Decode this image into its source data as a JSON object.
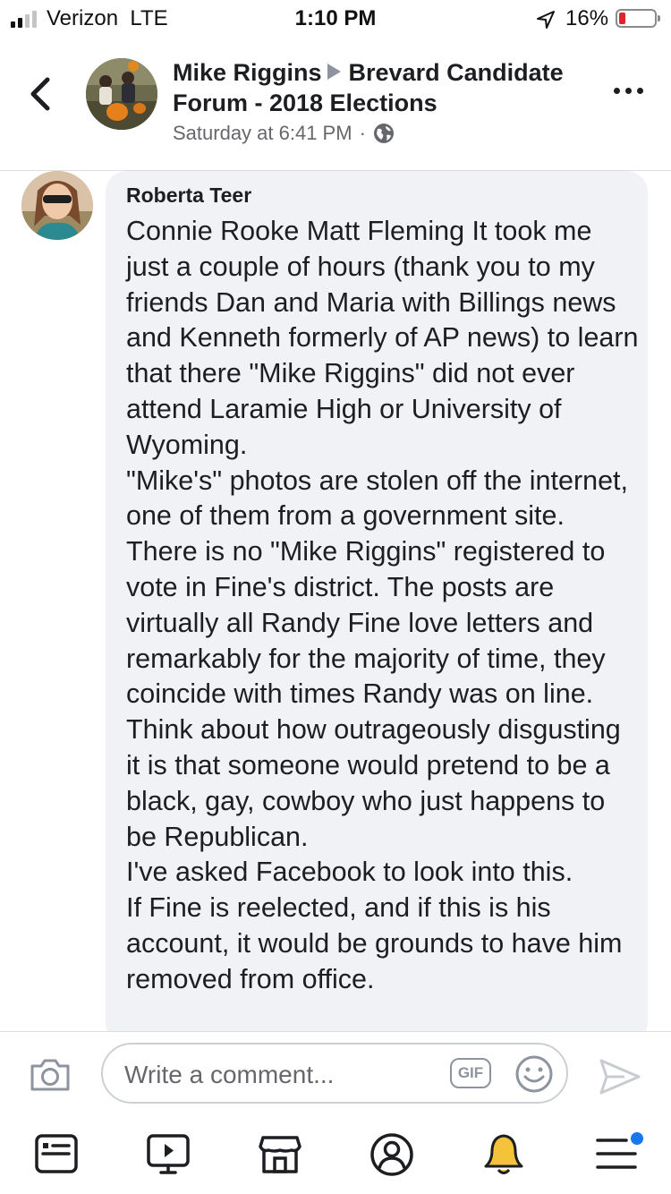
{
  "status_bar": {
    "carrier": "Verizon",
    "network": "LTE",
    "time": "1:10 PM",
    "battery_percent": "16%",
    "battery_level": 0.16,
    "battery_color": "#e0242d",
    "signal_bars_filled": 2,
    "signal_bars_total": 4
  },
  "header": {
    "author": "Mike Riggins",
    "group": "Brevard Candidate Forum - 2018 Elections",
    "timestamp": "Saturday at 6:41 PM",
    "separator": "·",
    "privacy_icon": "globe-icon",
    "back_icon": "chevron-left-icon",
    "more_icon": "more-dots-icon"
  },
  "comment": {
    "author": "Roberta Teer",
    "text": "Connie Rooke Matt Fleming It took me just a couple of hours (thank you to my friends Dan and Maria with Billings news and Kenneth formerly of AP news) to learn that there \"Mike Riggins\" did not ever attend Laramie High or University of Wyoming.\n\"Mike's\" photos are stolen off the internet, one of them from a government site. There is no \"Mike Riggins\" registered to vote in Fine's district. The posts are virtually all Randy Fine love letters and remarkably for the majority of time, they coincide with times Randy was on line.\nThink about how outrageously disgusting it is that someone would pretend to be a black, gay, cowboy who just happens to be Republican.\nI've asked Facebook  to look into this.\nIf Fine is reelected, and if this is his account, it would be grounds to have him removed from office."
  },
  "composer": {
    "placeholder": "Write a comment...",
    "gif_label": "GIF",
    "camera_icon": "camera-icon",
    "emoji_icon": "smiley-icon",
    "send_icon": "send-icon"
  },
  "tab_bar": {
    "items": [
      "news-feed-icon",
      "watch-icon",
      "marketplace-icon",
      "profile-icon",
      "notifications-icon",
      "menu-icon"
    ],
    "accent": "#1877f2",
    "bell_color": "#f5c33b"
  }
}
